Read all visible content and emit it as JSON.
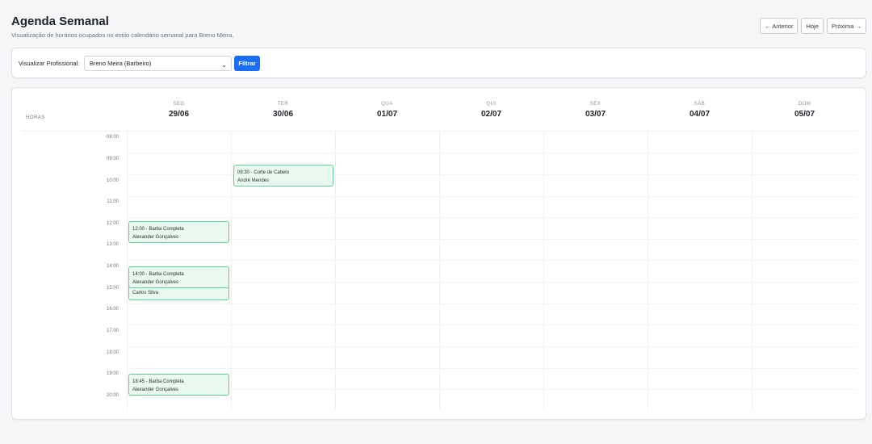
{
  "header": {
    "title": "Agenda Semanal",
    "subtitle": "Visualização de horários ocupados no estilo calendário semanal para Breno Meira."
  },
  "nav": {
    "prev_label": "← Anterior",
    "today_label": "Hoje",
    "next_label": "Próxima →"
  },
  "filter": {
    "label": "Visualizar Profissional:",
    "selected": "Breno Meira (Barbeiro)",
    "button_label": "Filtrar"
  },
  "calendar": {
    "hours_header": "HORAS",
    "days": [
      {
        "name": "SEG",
        "date": "29/06"
      },
      {
        "name": "TER",
        "date": "30/06"
      },
      {
        "name": "QUA",
        "date": "01/07"
      },
      {
        "name": "QUI",
        "date": "02/07"
      },
      {
        "name": "SEX",
        "date": "03/07"
      },
      {
        "name": "SÁB",
        "date": "04/07"
      },
      {
        "name": "DOM",
        "date": "05/07"
      }
    ],
    "hours": [
      "08:00",
      "09:00",
      "10:00",
      "11:00",
      "12:00",
      "13:00",
      "14:00",
      "15:00",
      "16:00",
      "17:00",
      "18:00",
      "19:00",
      "20:00"
    ],
    "events": [
      {
        "title": "09:30 - Corte de Cabelo",
        "client": "André Mendes"
      },
      {
        "title": "12:00 - Barba Completa",
        "client": "Alexander Gonçalves"
      },
      {
        "title": "",
        "client": "Carlos Silva"
      },
      {
        "title": "14:00 - Barba Completa",
        "client": "Alexander Gonçalves"
      },
      {
        "title": "18:45 - Barba Completa",
        "client": "Alexander Gonçalves"
      }
    ]
  },
  "colors": {
    "primary": "#1a6ef5",
    "event_bg": "#e9fbf1",
    "event_border": "#5fcf96"
  }
}
